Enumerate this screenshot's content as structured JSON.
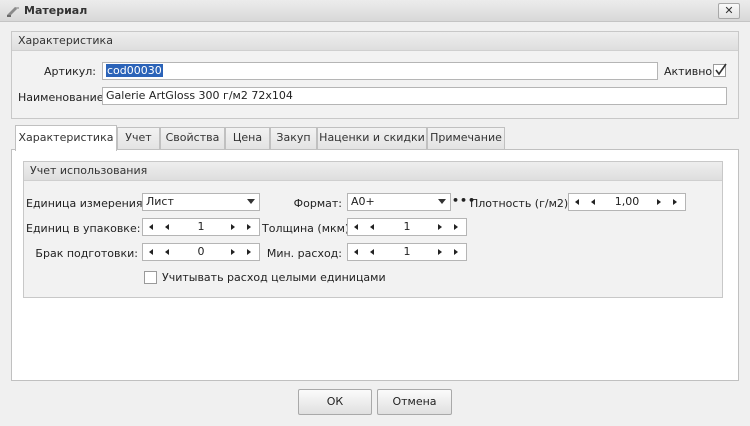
{
  "window": {
    "title": "Материал",
    "close": "✕"
  },
  "general": {
    "header": "Характеристика",
    "article_label": "Артикул:",
    "article_value": "cod00030",
    "active_label": "Активно",
    "active_checked": true,
    "name_label": "Наименование:",
    "name_value": "Galerie ArtGloss 300 г/м2 72x104"
  },
  "tabs": [
    "Характеристика",
    "Учет",
    "Свойства",
    "Цена",
    "Закуп",
    "Наценки и скидки",
    "Примечание"
  ],
  "active_tab": 0,
  "usage": {
    "header": "Учет использования",
    "unit_label": "Единица измерения:",
    "unit_value": "Лист",
    "format_label": "Формат:",
    "format_value": "А0+",
    "format_more": "•••",
    "density_label": "Плотность (г/м2):",
    "density_value": "1,00",
    "pack_label": "Единиц в упаковке:",
    "pack_value": "1",
    "thickness_label": "Толщина (мкм):",
    "thickness_value": "1",
    "waste_label": "Брак подготовки:",
    "waste_value": "0",
    "min_label": "Мин. расход:",
    "min_value": "1",
    "whole_units_label": "Учитывать расход целыми единицами",
    "whole_units_checked": false
  },
  "buttons": {
    "ok": "ОК",
    "cancel": "Отмена"
  }
}
